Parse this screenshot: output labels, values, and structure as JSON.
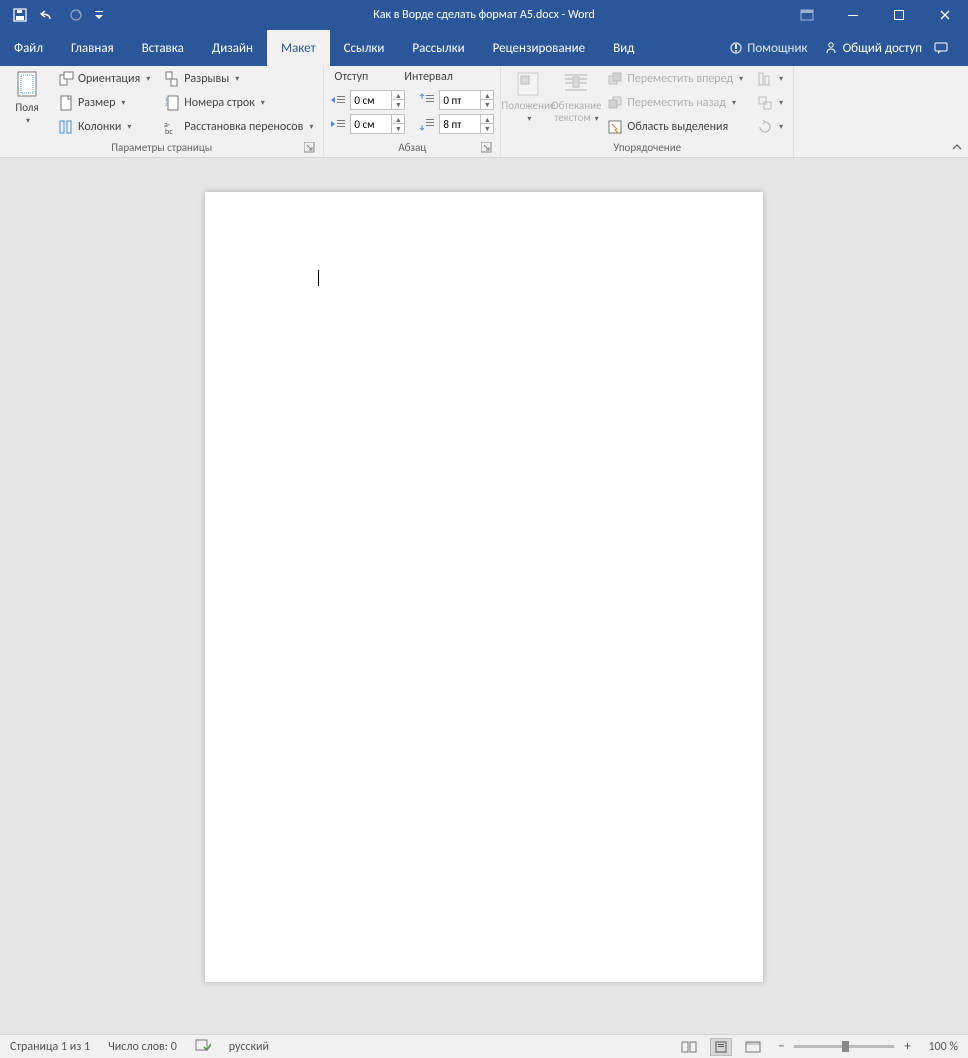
{
  "title": "Как в Ворде сделать формат А5.docx - Word",
  "tabs": {
    "file": "Файл",
    "home": "Главная",
    "insert": "Вставка",
    "design": "Дизайн",
    "layout": "Макет",
    "references": "Ссылки",
    "mailings": "Рассылки",
    "review": "Рецензирование",
    "view": "Вид",
    "helper": "Помощник",
    "share": "Общий доступ"
  },
  "ribbon": {
    "margins": "Поля",
    "orientation": "Ориентация",
    "size": "Размер",
    "columns": "Колонки",
    "breaks": "Разрывы",
    "linenumbers": "Номера строк",
    "hyphenation": "Расстановка переносов",
    "page_setup_group": "Параметры страницы",
    "indent_label": "Отступ",
    "spacing_label": "Интервал",
    "indent_left": "0 см",
    "indent_right": "0 см",
    "spacing_before": "0 пт",
    "spacing_after": "8 пт",
    "paragraph_group": "Абзац",
    "position": "Положение",
    "wrap": "Обтекание текстом",
    "bring_forward": "Переместить вперед",
    "send_backward": "Переместить назад",
    "selection_pane": "Область выделения",
    "arrange_group": "Упорядочение"
  },
  "status": {
    "page": "Страница 1 из 1",
    "words": "Число слов: 0",
    "lang": "русский",
    "zoom": "100 %"
  }
}
